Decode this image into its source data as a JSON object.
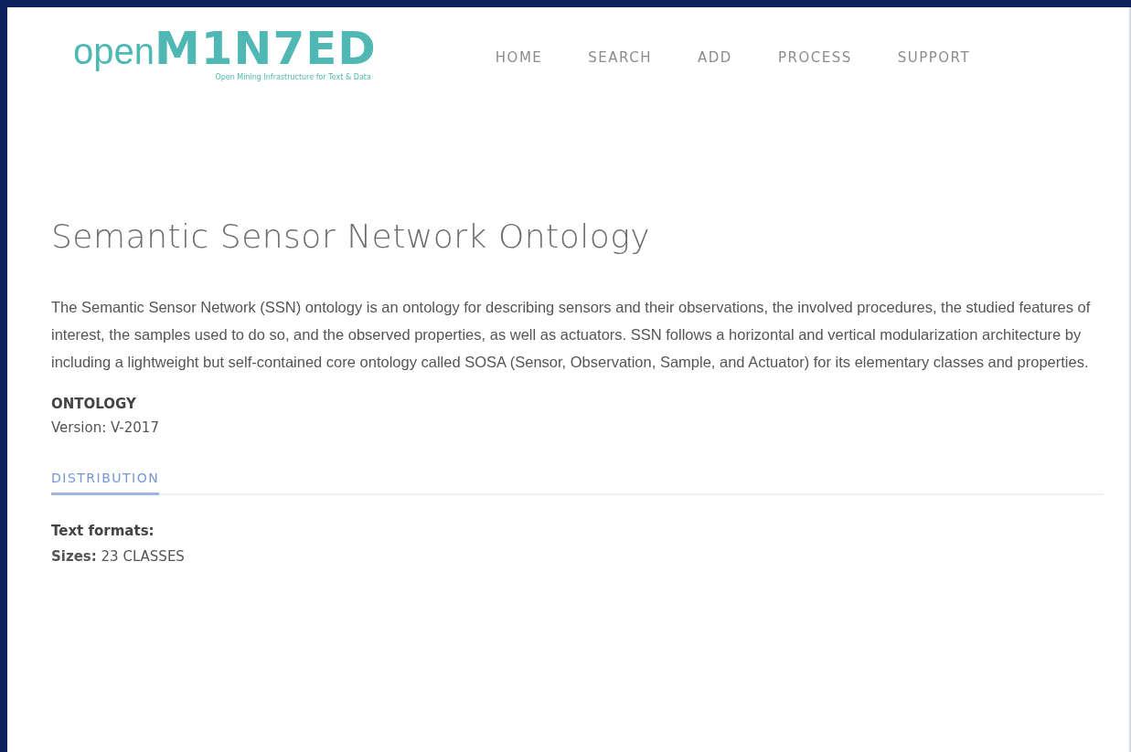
{
  "header": {
    "logo": {
      "light": "open",
      "bold": "M1N7ED",
      "tagline": "Open Mining Infrastructure for Text & Data"
    },
    "nav": [
      {
        "label": "HOME"
      },
      {
        "label": "SEARCH"
      },
      {
        "label": "ADD"
      },
      {
        "label": "PROCESS"
      },
      {
        "label": "SUPPORT"
      }
    ]
  },
  "title": "Semantic Sensor Network Ontology",
  "description": "The Semantic Sensor Network (SSN) ontology is an ontology for describing sensors and their observations, the involved procedures, the studied features of interest, the samples used to do so, and the observed properties, as well as actuators. SSN follows a horizontal and vertical modularization architecture by including a lightweight but self-contained core ontology called SOSA (Sensor, Observation, Sample, and Actuator) for its elementary classes and properties.",
  "resource_type": "ONTOLOGY",
  "version": "Version: V-2017",
  "tabs": [
    {
      "label": "DISTRIBUTION",
      "selected": true
    }
  ],
  "distribution": {
    "formats": "Text formats:",
    "sizes": "**Sizes:** 23 CLASSES"
  }
}
